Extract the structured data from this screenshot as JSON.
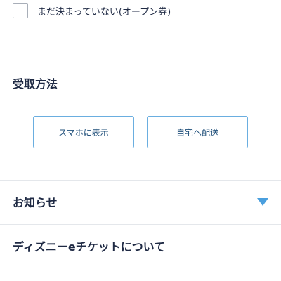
{
  "ticket_option": {
    "checkbox_label": "まだ決まっていない(オープン券)",
    "checked": false
  },
  "receive_method": {
    "title": "受取方法",
    "options": [
      {
        "label": "スマホに表示"
      },
      {
        "label": "自宅へ配送"
      }
    ]
  },
  "accordion": [
    {
      "title": "お知らせ",
      "icon": "triangle-down-icon"
    },
    {
      "title": "ディズニーeチケットについて"
    }
  ],
  "colors": {
    "accent": "#4a9fde",
    "text": "#1f2a44",
    "button_border": "#6aaee0"
  }
}
